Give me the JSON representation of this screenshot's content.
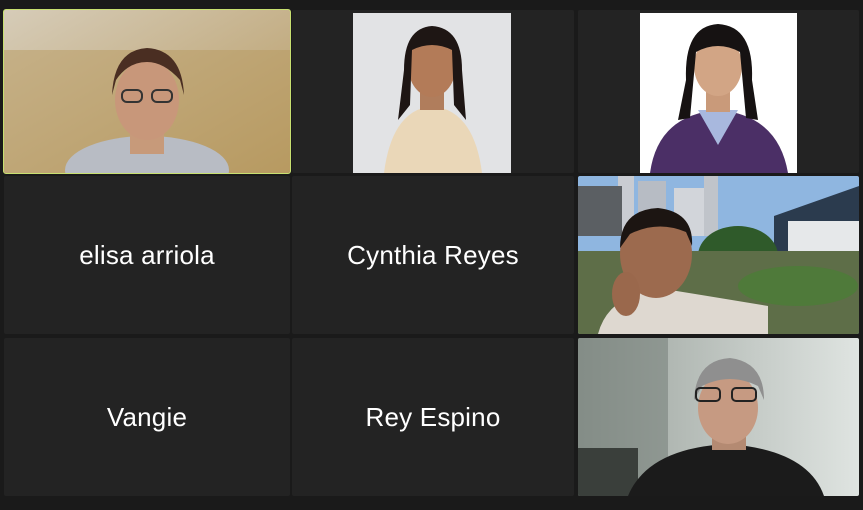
{
  "participants": [
    {
      "name": "elisa arriola",
      "video": false
    },
    {
      "name": "Cynthia Reyes",
      "video": false
    },
    {
      "name": "Vangie",
      "video": false
    },
    {
      "name": "Rey Espino",
      "video": false
    }
  ],
  "colors": {
    "active_speaker_border": "#c8e070",
    "tile_background": "#232323",
    "gallery_background": "#1a1a1a"
  }
}
